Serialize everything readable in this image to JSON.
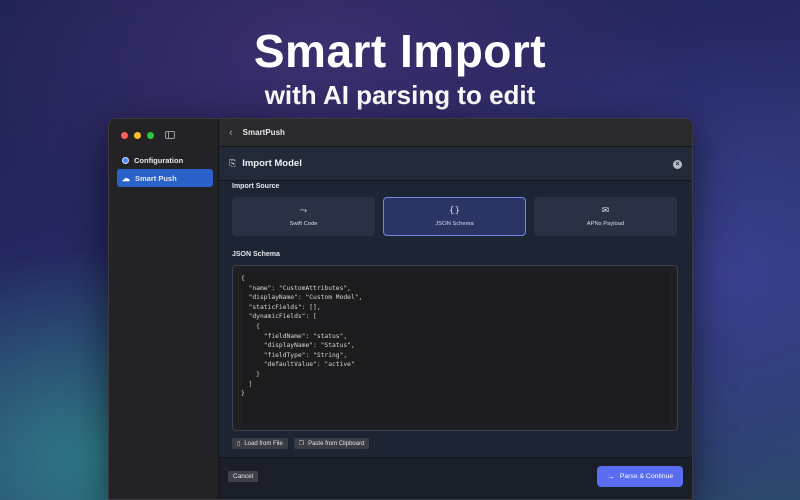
{
  "hero": {
    "title": "Smart Import",
    "subtitle": "with AI parsing to edit"
  },
  "sidebar": {
    "items": [
      {
        "label": "Configuration",
        "icon": "gear-dot-icon",
        "selected": false
      },
      {
        "label": "Smart Push",
        "icon": "push-icon",
        "selected": true
      }
    ]
  },
  "topbar": {
    "title": "SmartPush"
  },
  "modal": {
    "title": "Import Model",
    "source_label": "Import Source",
    "sources": [
      {
        "label": "Swift Code",
        "icon": "swift-icon",
        "glyph": "⤳",
        "selected": false
      },
      {
        "label": "JSON Schema",
        "icon": "braces-icon",
        "glyph": "{}",
        "selected": true
      },
      {
        "label": "APNs Payload",
        "icon": "envelope-icon",
        "glyph": "✉",
        "selected": false
      }
    ],
    "schema_label": "JSON Schema",
    "code": "{\n  \"name\": \"CustomAttributes\",\n  \"displayName\": \"Custom Model\",\n  \"staticFields\": [],\n  \"dynamicFields\": [\n    {\n      \"fieldName\": \"status\",\n      \"displayName\": \"Status\",\n      \"fieldType\": \"String\",\n      \"defaultValue\": \"active\"\n    }\n  ]\n}",
    "load_label": "Load from File",
    "paste_label": "Paste from Clipboard",
    "cancel_label": "Cancel",
    "primary_label": "Parse & Continue"
  },
  "colors": {
    "accent": "#5a6df0",
    "sidebar_selected": "#2a62c9"
  }
}
